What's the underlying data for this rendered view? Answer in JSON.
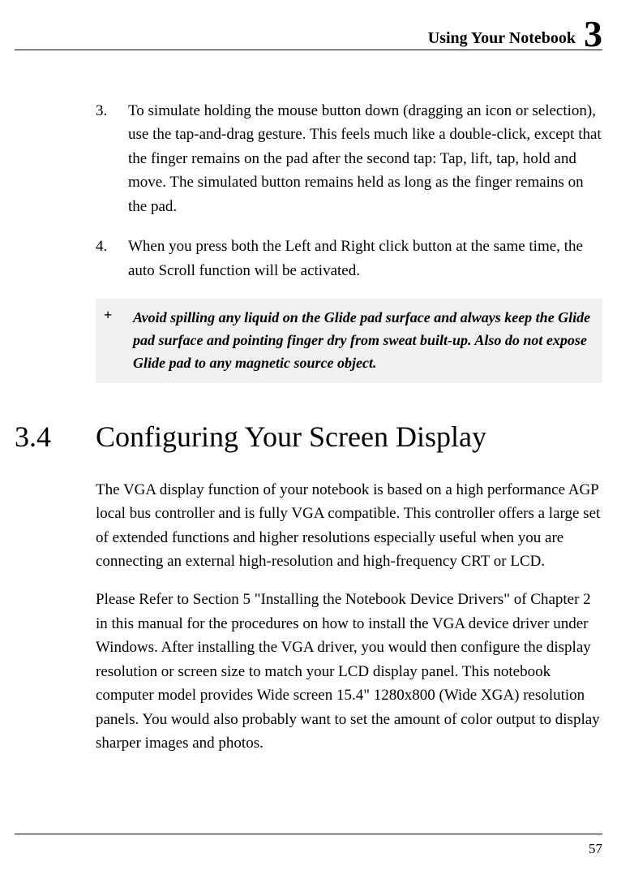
{
  "header": {
    "title": "Using Your Notebook",
    "chapter": "3"
  },
  "items": [
    {
      "num": "3.",
      "text": "To simulate holding the mouse button down (dragging an icon or selection), use the tap-and-drag gesture. This feels much like a double-click, except that the finger remains on the pad after the second tap: Tap, lift, tap, hold and move. The simulated button remains held as long as the finger remains on the pad."
    },
    {
      "num": "4.",
      "text": "When you press both the Left and Right click button at the same time, the auto Scroll function will be activated."
    }
  ],
  "note": {
    "marker": "+",
    "text": "Avoid spilling any liquid on the Glide pad surface and always keep the Glide pad surface and pointing finger dry from sweat built-up. Also do not expose Glide pad to any magnetic source object."
  },
  "section": {
    "number": "3.4",
    "title": "Configuring Your Screen Display"
  },
  "paragraphs": [
    "The VGA display function of your notebook is based on a high performance AGP local bus controller and is fully VGA compatible. This controller offers a large set of extended functions and higher resolutions especially useful when you are connecting an external high-resolution and high-frequency CRT or LCD.",
    "Please Refer to Section 5 \"Installing the Notebook Device Drivers\" of Chapter 2 in this manual for the procedures on how to install the VGA device driver under Windows. After installing the VGA driver, you would then configure the display resolution or screen size to match your LCD display panel. This notebook computer model provides Wide screen 15.4\" 1280x800 (Wide XGA) resolution panels. You would also probably want to set the amount of color output to display sharper images and photos."
  ],
  "page_number": "57"
}
